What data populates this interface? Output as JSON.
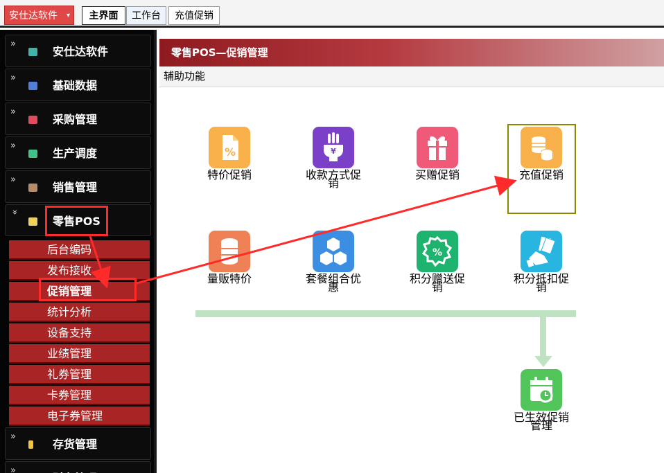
{
  "topbar": {
    "brand": "安仕达软件",
    "brand_caret": "▾",
    "tabs": [
      "主界面",
      "工作台",
      "充值促销"
    ]
  },
  "sidebar": {
    "items": [
      {
        "label": "安仕达软件",
        "icon": "teal-square-icon",
        "color": "#3fb3a4",
        "chevron": "»"
      },
      {
        "label": "基础数据",
        "icon": "blue-square-icon",
        "color": "#4f7fd6",
        "chevron": "»"
      },
      {
        "label": "采购管理",
        "icon": "red-square-icon",
        "color": "#e24a60",
        "chevron": "»"
      },
      {
        "label": "生产调度",
        "icon": "green-square-icon",
        "color": "#43c08a",
        "chevron": "»"
      },
      {
        "label": "销售管理",
        "icon": "brown-square-icon",
        "color": "#b68a6a",
        "chevron": "»"
      },
      {
        "label": "零售POS",
        "icon": "yellow-square-icon",
        "color": "#f0d05a",
        "chevron": "»"
      },
      {
        "label": "存货管理",
        "icon": "gold-square-icon",
        "color": "#f0c43a",
        "chevron": "»"
      },
      {
        "label": "财务管理",
        "icon": "blue-square-icon",
        "color": "#4f7fd6",
        "chevron": "»"
      }
    ],
    "sub_items": [
      "后台编码",
      "发布接收",
      "促销管理",
      "统计分析",
      "设备支持",
      "业绩管理",
      "礼券管理",
      "卡券管理",
      "电子券管理"
    ]
  },
  "panel": {
    "title": "零售POS—促销管理",
    "subtitle": "辅助功能"
  },
  "functions": [
    {
      "name": "特价促销",
      "icon": "percent-document-icon",
      "color": "#f7b04a"
    },
    {
      "name": "收款方式促销",
      "icon": "payment-hand-icon",
      "color": "#7b40c8"
    },
    {
      "name": "买赠促销",
      "icon": "gift-icon",
      "color": "#ee5a78"
    },
    {
      "name": "充值促销",
      "icon": "coins-stack-icon",
      "color": "#f7b04a"
    },
    {
      "name": "量贩特价",
      "icon": "database-icon",
      "color": "#ee8256"
    },
    {
      "name": "套餐组合优惠",
      "icon": "cubes-icon",
      "color": "#3c8ee2"
    },
    {
      "name": "积分赠送促销",
      "icon": "percent-badge-icon",
      "color": "#1eb36e"
    },
    {
      "name": "积分抵扣促销",
      "icon": "cash-hand-icon",
      "color": "#28b6e0"
    },
    {
      "name": "已生效促销管理",
      "icon": "calendar-clock-icon",
      "color": "#52c55a"
    }
  ]
}
